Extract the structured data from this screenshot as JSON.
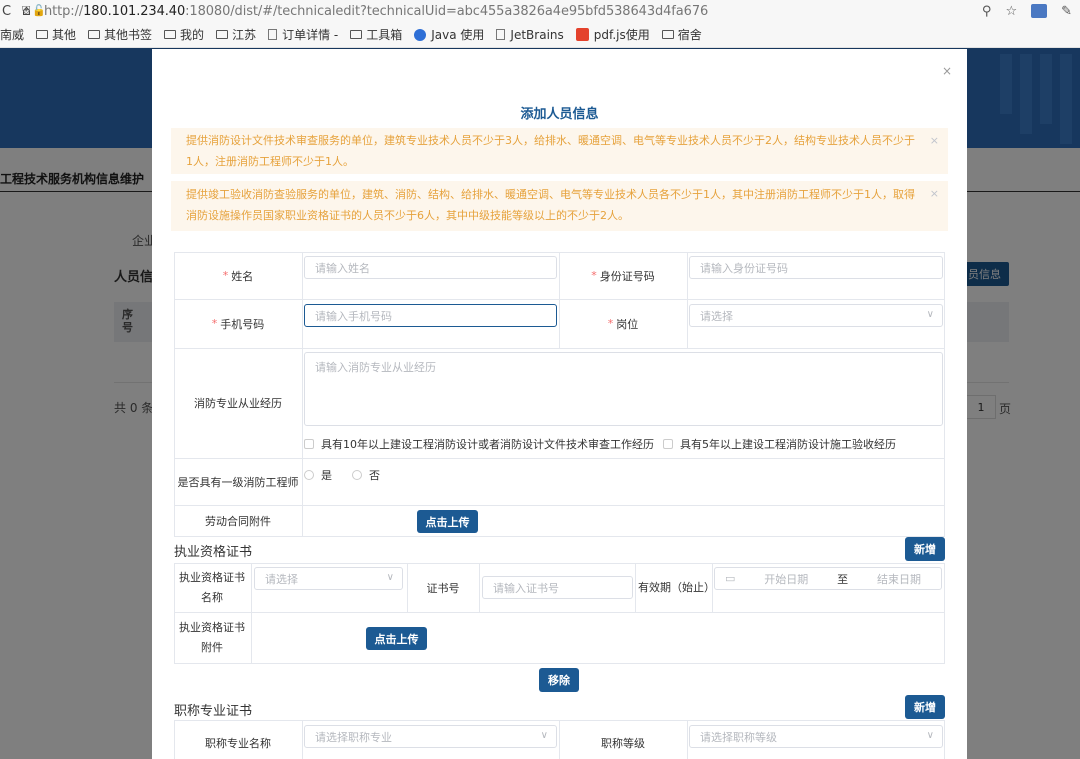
{
  "browser": {
    "url_prefix": "http://",
    "url_host": "180.101.234.40",
    "url_rest": ":18080/dist/#/technicaledit?technicalUid=abc455a3826a4e95bfd538643d4fa676",
    "bookmarks": [
      "南威",
      "其他",
      "其他书签",
      "我的",
      "江苏",
      "订单详情 -",
      "工具箱",
      "Java 使用",
      "JetBrains",
      "pdf.js使用",
      "宿舍"
    ]
  },
  "background": {
    "page_title": "工程技术服务机构信息维护",
    "tab": "企业",
    "section": "人员信",
    "table_header": "序\n号",
    "total": "共 0 条",
    "add_button": "员信息",
    "page_num": "1",
    "page_suffix": "页"
  },
  "modal": {
    "close": "×",
    "title": "添加人员信息",
    "alerts": [
      "提供消防设计文件技术审查服务的单位，建筑专业技术人员不少于3人，给排水、暖通空调、电气等专业技术人员不少于2人，结构专业技术人员不少于1人，注册消防工程师不少于1人。",
      "提供竣工验收消防查验服务的单位，建筑、消防、结构、给排水、暖通空调、电气等专业技术人员各不少于1人，其中注册消防工程师不少于1人，取得消防设施操作员国家职业资格证书的人员不少于6人，其中中级技能等级以上的不少于2人。"
    ],
    "alert_close": "×",
    "required_mark": "*",
    "form": {
      "name_label": "姓名",
      "name_placeholder": "请输入姓名",
      "id_label": "身份证号码",
      "id_placeholder": "请输入身份证号码",
      "phone_label": "手机号码",
      "phone_placeholder": "请输入手机号码",
      "post_label": "岗位",
      "post_placeholder": "请选择",
      "exp_label": "消防专业从业经历",
      "exp_placeholder": "请输入消防专业从业经历",
      "check1": "具有10年以上建设工程消防设计或者消防设计文件技术审查工作经历",
      "check2": "具有5年以上建设工程消防设计施工验收经历",
      "engineer_label": "是否具有一级消防工程师",
      "yes": "是",
      "no": "否",
      "contract_label": "劳动合同附件",
      "upload": "点击上传"
    },
    "cert": {
      "title": "执业资格证书",
      "add": "新增",
      "name_label": "执业资格证书名称",
      "name_placeholder": "请选择",
      "no_label": "证书号",
      "no_placeholder": "请输入证书号",
      "valid_label": "有效期（始止）",
      "start_placeholder": "开始日期",
      "to": "至",
      "end_placeholder": "结束日期",
      "attach_label": "执业资格证书附件",
      "upload": "点击上传",
      "remove": "移除"
    },
    "title_cert": {
      "title": "职称专业证书",
      "add": "新增",
      "name_label": "职称专业名称",
      "name_placeholder": "请选择职称专业",
      "level_label": "职称等级",
      "level_placeholder": "请选择职称等级"
    }
  }
}
